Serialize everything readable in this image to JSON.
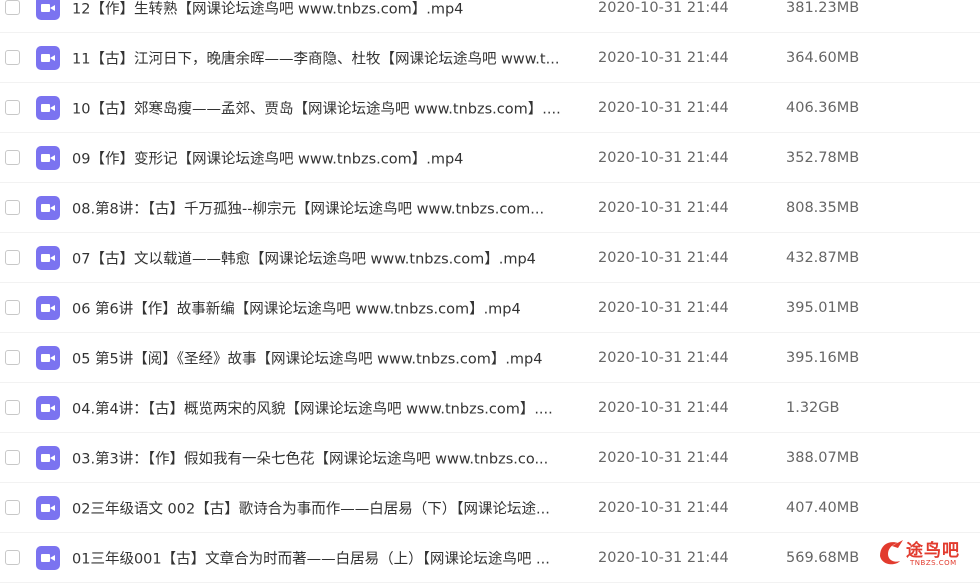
{
  "files": [
    {
      "name": "12【作】生转熟【网课论坛途鸟吧 www.tnbzs.com】.mp4",
      "date": "2020-10-31 21:44",
      "size": "381.23MB"
    },
    {
      "name": "11【古】江河日下，晚唐余晖——李商隐、杜牧【网课论坛途鸟吧 www.t...",
      "date": "2020-10-31 21:44",
      "size": "364.60MB"
    },
    {
      "name": "10【古】郊寒岛瘦——孟郊、贾岛【网课论坛途鸟吧 www.tnbzs.com】....",
      "date": "2020-10-31 21:44",
      "size": "406.36MB"
    },
    {
      "name": "09【作】变形记【网课论坛途鸟吧 www.tnbzs.com】.mp4",
      "date": "2020-10-31 21:44",
      "size": "352.78MB"
    },
    {
      "name": "08.第8讲：【古】千万孤独--柳宗元【网课论坛途鸟吧 www.tnbzs.com...",
      "date": "2020-10-31 21:44",
      "size": "808.35MB"
    },
    {
      "name": "07【古】文以载道——韩愈【网课论坛途鸟吧 www.tnbzs.com】.mp4",
      "date": "2020-10-31 21:44",
      "size": "432.87MB"
    },
    {
      "name": "06 第6讲【作】故事新编【网课论坛途鸟吧 www.tnbzs.com】.mp4",
      "date": "2020-10-31 21:44",
      "size": "395.01MB"
    },
    {
      "name": "05 第5讲【阅】《圣经》故事【网课论坛途鸟吧 www.tnbzs.com】.mp4",
      "date": "2020-10-31 21:44",
      "size": "395.16MB"
    },
    {
      "name": "04.第4讲：【古】概览两宋的风貌【网课论坛途鸟吧 www.tnbzs.com】....",
      "date": "2020-10-31 21:44",
      "size": "1.32GB"
    },
    {
      "name": "03.第3讲：【作】假如我有一朵七色花【网课论坛途鸟吧 www.tnbzs.co...",
      "date": "2020-10-31 21:44",
      "size": "388.07MB"
    },
    {
      "name": "02三年级语文 002【古】歌诗合为事而作——白居易（下）【网课论坛途...",
      "date": "2020-10-31 21:44",
      "size": "407.40MB"
    },
    {
      "name": "01三年级001【古】文章合为时而著——白居易（上）【网课论坛途鸟吧 ...",
      "date": "2020-10-31 21:44",
      "size": "569.68MB"
    }
  ],
  "watermark": {
    "text": "途鸟吧",
    "subtext": "TNBZS.COM"
  },
  "colors": {
    "file_icon": "#7b73f0",
    "watermark": "#e23b2e"
  }
}
